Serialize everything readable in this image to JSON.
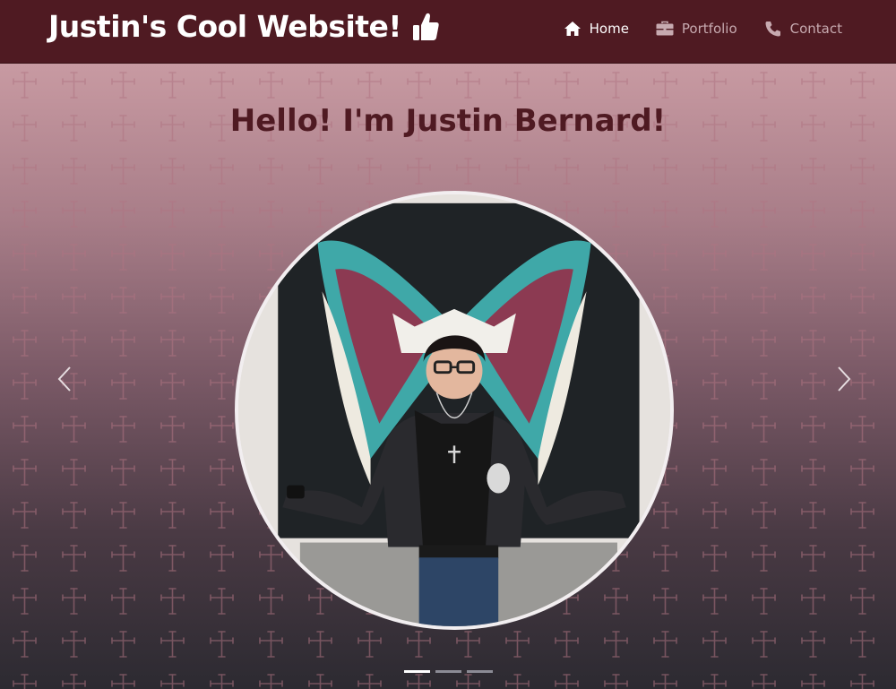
{
  "site": {
    "brand": "Justin's Cool Website!",
    "brand_icon": "thumbs-up-icon"
  },
  "nav": {
    "items": [
      {
        "label": "Home",
        "icon": "home-icon",
        "active": true
      },
      {
        "label": "Portfolio",
        "icon": "briefcase-icon",
        "active": false
      },
      {
        "label": "Contact",
        "icon": "phone-icon",
        "active": false
      }
    ]
  },
  "hero": {
    "heading": "Hello! I'm Justin Bernard!",
    "carousel": {
      "slide_count": 3,
      "active_index": 0,
      "prev_icon": "chevron-left-icon",
      "next_icon": "chevron-right-icon"
    }
  },
  "colors": {
    "navbar": "#4f1a22",
    "heading": "#4f1a22",
    "nav_inactive": "#c7aab0",
    "nav_active": "#ffffff"
  }
}
